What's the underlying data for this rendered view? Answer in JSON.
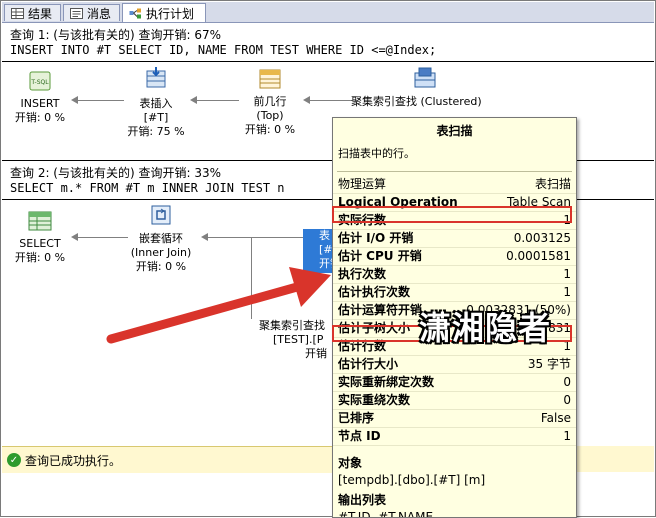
{
  "tabs": [
    {
      "label": "结果",
      "icon": "grid-icon"
    },
    {
      "label": "消息",
      "icon": "messages-icon"
    },
    {
      "label": "执行计划",
      "icon": "execution-plan-icon"
    }
  ],
  "query1": {
    "header": "查询 1: (与该批有关的) 查询开销: 67%",
    "sql": "INSERT INTO #T SELECT ID, NAME FROM TEST WHERE ID <=@Index;",
    "nodes": {
      "insert": {
        "name": "INSERT",
        "cost": "开销: 0 %"
      },
      "table_insert": {
        "name": "表插入",
        "sub": "[#T]",
        "cost": "开销: 75 %"
      },
      "top": {
        "name": "前几行",
        "sub": "(Top)",
        "cost": "开销: 0 %"
      },
      "cix_scan": {
        "name": "聚集索引查找 (Clustered)",
        "sub": "[TEST].[PK_TEST]"
      }
    }
  },
  "query2": {
    "header": "查询 2: (与该批有关的) 查询开销: 33%",
    "sql": "SELECT m.* FROM #T m INNER JOIN TEST n",
    "nodes": {
      "select": {
        "name": "SELECT",
        "cost": "开销: 0 %"
      },
      "nested_loops": {
        "name": "嵌套循环",
        "sub": "(Inner Join)",
        "cost": "开销: 0 %"
      },
      "table_scan": {
        "name": "表",
        "sub": "[#",
        "cost": "开销"
      },
      "cix_seek": {
        "name": "聚集索引查找",
        "sub": "[TEST].[P",
        "cost": "开销"
      }
    }
  },
  "tooltip": {
    "title": "表扫描",
    "description": "扫描表中的行。",
    "rows": [
      {
        "k": "物理运算",
        "v": "表扫描"
      },
      {
        "k": "Logical Operation",
        "v": "Table Scan"
      },
      {
        "k": "实际行数",
        "v": "1"
      },
      {
        "k": "估计 I/O 开销",
        "v": "0.003125"
      },
      {
        "k": "估计 CPU 开销",
        "v": "0.0001581"
      },
      {
        "k": "执行次数",
        "v": "1"
      },
      {
        "k": "估计执行次数",
        "v": "1"
      },
      {
        "k": "估计运算符开销",
        "v": "0.0032831 (50%)"
      },
      {
        "k": "估计子树大小",
        "v": "0.0032831"
      },
      {
        "k": "估计行数",
        "v": "1"
      },
      {
        "k": "估计行大小",
        "v": "35 字节"
      },
      {
        "k": "实际重新绑定次数",
        "v": "0"
      },
      {
        "k": "实际重绕次数",
        "v": "0"
      },
      {
        "k": "已排序",
        "v": "False"
      },
      {
        "k": "节点 ID",
        "v": "1"
      }
    ],
    "object_label": "对象",
    "object_value": "[tempdb].[dbo].[#T] [m]",
    "output_label": "输出列表",
    "output_value": "#T.ID, #T.NAME"
  },
  "status": {
    "text": "查询已成功执行。"
  },
  "watermark": "潇湘隐者"
}
